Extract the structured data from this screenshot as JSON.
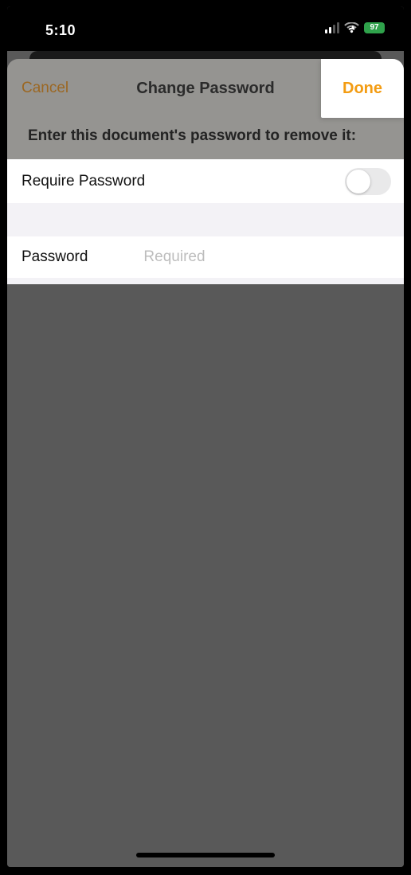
{
  "status": {
    "time": "5:10",
    "battery": "97"
  },
  "nav": {
    "cancel_label": "Cancel",
    "title": "Change Password",
    "done_label": "Done"
  },
  "prompt": "Enter this document's password to remove it:",
  "require_row": {
    "label": "Require Password",
    "enabled": false
  },
  "password_row": {
    "label": "Password",
    "placeholder": "Required",
    "value": ""
  },
  "colors": {
    "accent": "#f39c12",
    "dim_bg": "#959491",
    "dark_bg": "#595959"
  }
}
